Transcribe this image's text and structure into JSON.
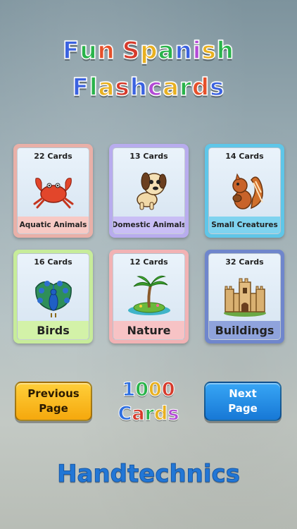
{
  "title": {
    "line1": [
      "F",
      "u",
      "n",
      " ",
      "S",
      "p",
      "a",
      "n",
      "i",
      "s",
      "h"
    ],
    "line2": [
      "F",
      "l",
      "a",
      "s",
      "h",
      "c",
      "a",
      "r",
      "d",
      "s"
    ],
    "line1_colors": [
      "#3b62e0",
      "#29b34a",
      "#e5502a",
      "",
      "#d63a2b",
      "#e8b020",
      "#29b34a",
      "#3b62e0",
      "#b34ad6",
      "#e8b020",
      "#29b34a"
    ],
    "line2_colors": [
      "#3b62e0",
      "#29b34a",
      "#e8b020",
      "#d63a2b",
      "#3b62e0",
      "#b34ad6",
      "#e8b020",
      "#29b34a",
      "#e5502a",
      "#3b62e0"
    ]
  },
  "categories": [
    {
      "count": "22 Cards",
      "label": "Aquatic Animals",
      "icon": "crab-icon",
      "frame": "#e9b0a8",
      "label_bg": "#f7c9c4"
    },
    {
      "count": "13 Cards",
      "label": "Domestic Animals",
      "icon": "puppy-icon",
      "frame": "#b8acee",
      "label_bg": "#c9bef5"
    },
    {
      "count": "14 Cards",
      "label": "Small Creatures",
      "icon": "squirrel-icon",
      "frame": "#5fc6e8",
      "label_bg": "#7fd3ef"
    },
    {
      "count": "16 Cards",
      "label": "Birds",
      "icon": "peacock-icon",
      "frame": "#c7ec9a",
      "label_bg": "#d3f2a8"
    },
    {
      "count": "12 Cards",
      "label": "Nature",
      "icon": "palm-island-icon",
      "frame": "#f2b2b4",
      "label_bg": "#f7c3c5"
    },
    {
      "count": "32 Cards",
      "label": "Buildings",
      "icon": "castle-icon",
      "frame": "#6f86cc",
      "label_bg": "#8fa3dc"
    }
  ],
  "nav": {
    "prev_line1": "Previous",
    "prev_line2": "Page",
    "next_line1": "Next",
    "next_line2": "Page"
  },
  "total": {
    "line1": "1000",
    "line2": "Cards",
    "line1_colors": [
      "#2f6fe0",
      "#29b34a",
      "#e8b020",
      "#d63a2b"
    ],
    "line2_colors": [
      "#2f6fe0",
      "#d63a2b",
      "#29b34a",
      "#e8b020",
      "#b34ad6"
    ]
  },
  "brand": "Handtechnics"
}
